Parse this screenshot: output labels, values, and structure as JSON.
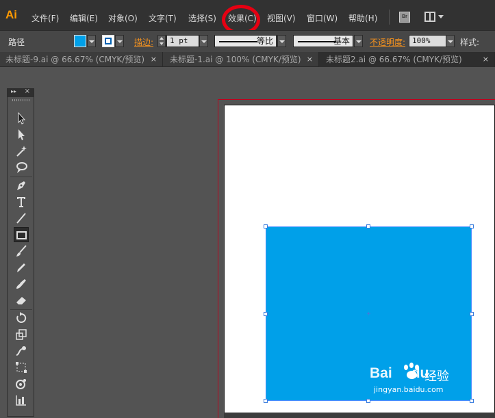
{
  "app": {
    "logo": "Ai",
    "accent_color": "#ff9a00"
  },
  "menu": {
    "items": [
      "文件(F)",
      "编辑(E)",
      "对象(O)",
      "文字(T)",
      "选择(S)",
      "效果(C)",
      "视图(V)",
      "窗口(W)",
      "帮助(H)"
    ],
    "bridge_label": "Br",
    "highlighted_item": "效果(C)",
    "highlight_color": "#e60012"
  },
  "control": {
    "selection_label": "路径",
    "fill_color": "#00a0e9",
    "stroke_label": "描边:",
    "stroke_weight": "1 pt",
    "profile_label": "等比",
    "brush_label": "基本",
    "opacity_label": "不透明度:",
    "opacity_value": "100%",
    "style_label": "样式:"
  },
  "tabs": [
    {
      "label": "未标题-9.ai @ 66.67% (CMYK/预览)",
      "close": "×"
    },
    {
      "label": "未标题-1.ai @ 100% (CMYK/预览)",
      "close": "×"
    },
    {
      "label": "未标题2.ai @ 66.67% (CMYK/预览)",
      "close": "×"
    }
  ],
  "toolbox": {
    "collapse_glyph": "▸▸",
    "close_glyph": "×",
    "tools": [
      "selection-tool",
      "direct-selection-tool",
      "magic-wand-tool",
      "lasso-tool",
      "pen-tool",
      "type-tool",
      "line-segment-tool",
      "rectangle-tool",
      "paintbrush-tool",
      "pencil-tool",
      "blob-brush-tool",
      "eraser-tool",
      "rotate-tool",
      "scale-tool",
      "warp-tool",
      "free-transform-tool",
      "symbol-sprayer-tool",
      "column-graph-tool"
    ],
    "active_tool": "rectangle-tool"
  },
  "canvas": {
    "shape_fill": "#00a0e9",
    "bleed_color": "#c2001d"
  },
  "watermark": {
    "brand": "Bai",
    "brand_suffix": "du",
    "product": "经验",
    "url": "jingyan.baidu.com"
  }
}
